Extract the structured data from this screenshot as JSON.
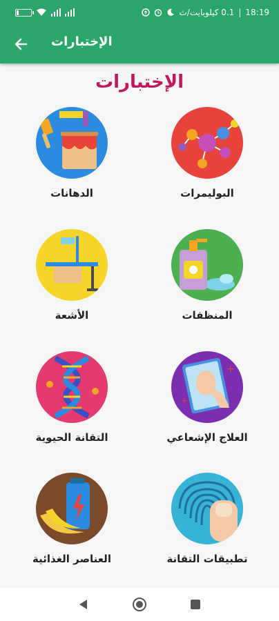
{
  "status": {
    "time": "18:19",
    "network": "0.1 كيلوبايت/ث",
    "signal_left": "",
    "battery_level": 0.15
  },
  "appbar": {
    "title": "الإختبارات",
    "back_icon": "arrow-back-icon"
  },
  "page": {
    "title": "الإختبارات"
  },
  "grid": [
    {
      "label": "البوليمرات",
      "icon": "polymers-molecule-icon",
      "color": "#e8433a"
    },
    {
      "label": "الدهانات",
      "icon": "paints-bucket-icon",
      "color": "#2b8be0"
    },
    {
      "label": "المنظفات",
      "icon": "detergents-bottle-icon",
      "color": "#4caf50"
    },
    {
      "label": "الأشعة",
      "icon": "xray-table-icon",
      "color": "#f5d52a"
    },
    {
      "label": "العلاج الإشعاعي",
      "icon": "radiotherapy-face-icon",
      "color": "#7b2fb0"
    },
    {
      "label": "التقانة الحيوية",
      "icon": "biotech-dna-icon",
      "color": "#e43a6f"
    },
    {
      "label": "تطبيقات التقانة",
      "icon": "fingerprint-icon",
      "color": "#36b3d6"
    },
    {
      "label": "العناصر الغذائية",
      "icon": "nutrients-banana-icon",
      "color": "#7a4a2a"
    }
  ],
  "navbar": {
    "back": "nav-back-icon",
    "home": "nav-home-icon",
    "recents": "nav-recents-icon"
  }
}
